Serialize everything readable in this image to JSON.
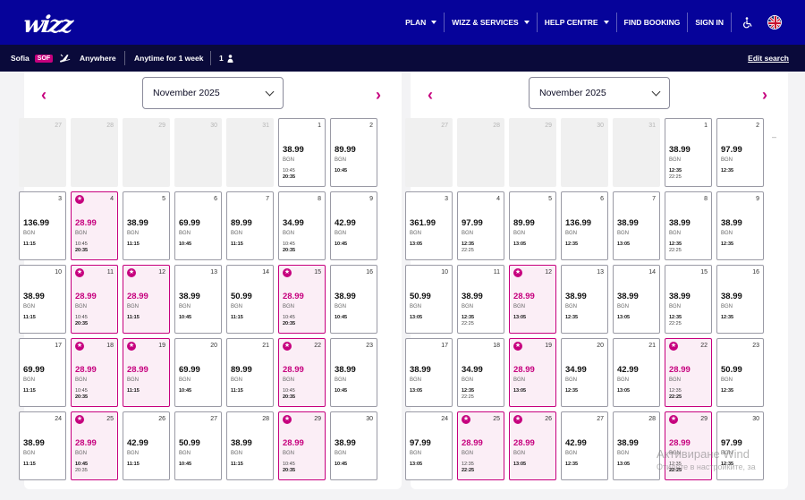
{
  "header": {
    "logo": "wizz",
    "nav": [
      {
        "label": "PLAN",
        "dropdown": true
      },
      {
        "label": "WIZZ & SERVICES",
        "dropdown": true
      },
      {
        "label": "HELP CENTRE",
        "dropdown": true
      },
      {
        "label": "FIND BOOKING",
        "dropdown": false
      },
      {
        "label": "SIGN IN",
        "dropdown": false
      }
    ],
    "accessibility_icon": "wheelchair-icon",
    "language_icon": "uk-flag-icon"
  },
  "search": {
    "origin": "Sofia",
    "origin_code": "SOF",
    "destination": "Anywhere",
    "dates": "Anytime for 1 week",
    "passengers": "1",
    "edit_label": "Edit search"
  },
  "calendars": [
    {
      "month": "November 2025",
      "days": [
        {
          "d": "27",
          "empty": true
        },
        {
          "d": "28",
          "empty": true
        },
        {
          "d": "29",
          "empty": true
        },
        {
          "d": "30",
          "empty": true
        },
        {
          "d": "31",
          "empty": true
        },
        {
          "d": "1",
          "p": "38.99",
          "cur": "BGN",
          "t": [
            "10:45",
            "20:35"
          ],
          "b": [
            false,
            true
          ]
        },
        {
          "d": "2",
          "p": "89.99",
          "cur": "BGN",
          "t": [
            "10:45"
          ],
          "b": [
            true
          ]
        },
        {
          "d": "3",
          "p": "136.99",
          "cur": "BGN",
          "t": [
            "11:15"
          ],
          "b": [
            true
          ]
        },
        {
          "d": "4",
          "p": "28.99",
          "cur": "BGN",
          "sale": true,
          "t": [
            "10:45",
            "20:35"
          ],
          "b": [
            false,
            true
          ]
        },
        {
          "d": "5",
          "p": "38.99",
          "cur": "BGN",
          "t": [
            "11:15"
          ],
          "b": [
            true
          ]
        },
        {
          "d": "6",
          "p": "69.99",
          "cur": "BGN",
          "t": [
            "10:45"
          ],
          "b": [
            true
          ]
        },
        {
          "d": "7",
          "p": "89.99",
          "cur": "BGN",
          "t": [
            "11:15"
          ],
          "b": [
            true
          ]
        },
        {
          "d": "8",
          "p": "34.99",
          "cur": "BGN",
          "t": [
            "10:45",
            "20:35"
          ],
          "b": [
            false,
            true
          ]
        },
        {
          "d": "9",
          "p": "42.99",
          "cur": "BGN",
          "t": [
            "10:45"
          ],
          "b": [
            true
          ]
        },
        {
          "d": "10",
          "p": "38.99",
          "cur": "BGN",
          "t": [
            "11:15"
          ],
          "b": [
            true
          ]
        },
        {
          "d": "11",
          "p": "28.99",
          "cur": "BGN",
          "sale": true,
          "t": [
            "10:45",
            "20:35"
          ],
          "b": [
            false,
            true
          ]
        },
        {
          "d": "12",
          "p": "28.99",
          "cur": "BGN",
          "sale": true,
          "t": [
            "11:15"
          ],
          "b": [
            true
          ]
        },
        {
          "d": "13",
          "p": "38.99",
          "cur": "BGN",
          "t": [
            "10:45"
          ],
          "b": [
            true
          ]
        },
        {
          "d": "14",
          "p": "50.99",
          "cur": "BGN",
          "t": [
            "11:15"
          ],
          "b": [
            true
          ]
        },
        {
          "d": "15",
          "p": "28.99",
          "cur": "BGN",
          "sale": true,
          "t": [
            "10:45",
            "20:35"
          ],
          "b": [
            false,
            true
          ]
        },
        {
          "d": "16",
          "p": "38.99",
          "cur": "BGN",
          "t": [
            "10:45"
          ],
          "b": [
            true
          ]
        },
        {
          "d": "17",
          "p": "69.99",
          "cur": "BGN",
          "t": [
            "11:15"
          ],
          "b": [
            true
          ]
        },
        {
          "d": "18",
          "p": "28.99",
          "cur": "BGN",
          "sale": true,
          "t": [
            "10:45",
            "20:35"
          ],
          "b": [
            false,
            true
          ]
        },
        {
          "d": "19",
          "p": "28.99",
          "cur": "BGN",
          "sale": true,
          "t": [
            "11:15"
          ],
          "b": [
            true
          ]
        },
        {
          "d": "20",
          "p": "69.99",
          "cur": "BGN",
          "t": [
            "10:45"
          ],
          "b": [
            true
          ]
        },
        {
          "d": "21",
          "p": "89.99",
          "cur": "BGN",
          "t": [
            "11:15"
          ],
          "b": [
            true
          ]
        },
        {
          "d": "22",
          "p": "28.99",
          "cur": "BGN",
          "sale": true,
          "t": [
            "10:45",
            "20:35"
          ],
          "b": [
            false,
            true
          ]
        },
        {
          "d": "23",
          "p": "38.99",
          "cur": "BGN",
          "t": [
            "10:45"
          ],
          "b": [
            true
          ]
        },
        {
          "d": "24",
          "p": "38.99",
          "cur": "BGN",
          "t": [
            "11:15"
          ],
          "b": [
            true
          ]
        },
        {
          "d": "25",
          "p": "28.99",
          "cur": "BGN",
          "sale": true,
          "t": [
            "10:45",
            "20:35"
          ],
          "b": [
            true,
            false
          ]
        },
        {
          "d": "26",
          "p": "42.99",
          "cur": "BGN",
          "t": [
            "11:15"
          ],
          "b": [
            true
          ]
        },
        {
          "d": "27",
          "p": "50.99",
          "cur": "BGN",
          "t": [
            "10:45"
          ],
          "b": [
            true
          ]
        },
        {
          "d": "28",
          "p": "38.99",
          "cur": "BGN",
          "t": [
            "11:15"
          ],
          "b": [
            true
          ]
        },
        {
          "d": "29",
          "p": "28.99",
          "cur": "BGN",
          "sale": true,
          "t": [
            "10:45",
            "20:35"
          ],
          "b": [
            false,
            true
          ]
        },
        {
          "d": "30",
          "p": "38.99",
          "cur": "BGN",
          "t": [
            "10:45"
          ],
          "b": [
            true
          ]
        }
      ]
    },
    {
      "month": "November 2025",
      "days": [
        {
          "d": "27",
          "empty": true
        },
        {
          "d": "28",
          "empty": true
        },
        {
          "d": "29",
          "empty": true
        },
        {
          "d": "30",
          "empty": true
        },
        {
          "d": "31",
          "empty": true
        },
        {
          "d": "1",
          "p": "38.99",
          "cur": "BGN",
          "t": [
            "12:35",
            "22:25"
          ],
          "b": [
            true,
            false
          ]
        },
        {
          "d": "2",
          "p": "97.99",
          "cur": "BGN",
          "t": [
            "12:35"
          ],
          "b": [
            true
          ]
        },
        {
          "d": "3",
          "p": "361.99",
          "cur": "BGN",
          "t": [
            "13:05"
          ],
          "b": [
            true
          ]
        },
        {
          "d": "4",
          "p": "97.99",
          "cur": "BGN",
          "t": [
            "12:35",
            "22:25"
          ],
          "b": [
            true,
            false
          ]
        },
        {
          "d": "5",
          "p": "89.99",
          "cur": "BGN",
          "t": [
            "13:05"
          ],
          "b": [
            true
          ]
        },
        {
          "d": "6",
          "p": "136.99",
          "cur": "BGN",
          "t": [
            "12:35"
          ],
          "b": [
            true
          ]
        },
        {
          "d": "7",
          "p": "38.99",
          "cur": "BGN",
          "t": [
            "13:05"
          ],
          "b": [
            true
          ]
        },
        {
          "d": "8",
          "p": "38.99",
          "cur": "BGN",
          "t": [
            "12:35",
            "22:25"
          ],
          "b": [
            true,
            false
          ]
        },
        {
          "d": "9",
          "p": "38.99",
          "cur": "BGN",
          "t": [
            "12:35"
          ],
          "b": [
            true
          ]
        },
        {
          "d": "10",
          "p": "50.99",
          "cur": "BGN",
          "t": [
            "13:05"
          ],
          "b": [
            true
          ]
        },
        {
          "d": "11",
          "p": "38.99",
          "cur": "BGN",
          "t": [
            "12:35",
            "22:25"
          ],
          "b": [
            true,
            false
          ]
        },
        {
          "d": "12",
          "p": "28.99",
          "cur": "BGN",
          "sale": true,
          "t": [
            "13:05"
          ],
          "b": [
            true
          ]
        },
        {
          "d": "13",
          "p": "38.99",
          "cur": "BGN",
          "t": [
            "12:35"
          ],
          "b": [
            true
          ]
        },
        {
          "d": "14",
          "p": "38.99",
          "cur": "BGN",
          "t": [
            "13:05"
          ],
          "b": [
            true
          ]
        },
        {
          "d": "15",
          "p": "38.99",
          "cur": "BGN",
          "t": [
            "12:35",
            "22:25"
          ],
          "b": [
            true,
            false
          ]
        },
        {
          "d": "16",
          "p": "38.99",
          "cur": "BGN",
          "t": [
            "12:35"
          ],
          "b": [
            true
          ]
        },
        {
          "d": "17",
          "p": "38.99",
          "cur": "BGN",
          "t": [
            "13:05"
          ],
          "b": [
            true
          ]
        },
        {
          "d": "18",
          "p": "34.99",
          "cur": "BGN",
          "t": [
            "12:35",
            "22:25"
          ],
          "b": [
            true,
            false
          ]
        },
        {
          "d": "19",
          "p": "28.99",
          "cur": "BGN",
          "sale": true,
          "t": [
            "13:05"
          ],
          "b": [
            true
          ]
        },
        {
          "d": "20",
          "p": "34.99",
          "cur": "BGN",
          "t": [
            "12:35"
          ],
          "b": [
            true
          ]
        },
        {
          "d": "21",
          "p": "42.99",
          "cur": "BGN",
          "t": [
            "13:05"
          ],
          "b": [
            true
          ]
        },
        {
          "d": "22",
          "p": "28.99",
          "cur": "BGN",
          "sale": true,
          "t": [
            "12:35",
            "22:25"
          ],
          "b": [
            false,
            true
          ]
        },
        {
          "d": "23",
          "p": "50.99",
          "cur": "BGN",
          "t": [
            "12:35"
          ],
          "b": [
            true
          ]
        },
        {
          "d": "24",
          "p": "97.99",
          "cur": "BGN",
          "t": [
            "13:05"
          ],
          "b": [
            true
          ]
        },
        {
          "d": "25",
          "p": "28.99",
          "cur": "BGN",
          "sale": true,
          "t": [
            "12:35",
            "22:25"
          ],
          "b": [
            false,
            true
          ]
        },
        {
          "d": "26",
          "p": "28.99",
          "cur": "BGN",
          "sale": true,
          "t": [
            "13:05"
          ],
          "b": [
            true
          ]
        },
        {
          "d": "27",
          "p": "42.99",
          "cur": "BGN",
          "t": [
            "12:35"
          ],
          "b": [
            true
          ]
        },
        {
          "d": "28",
          "p": "38.99",
          "cur": "BGN",
          "t": [
            "13:05"
          ],
          "b": [
            true
          ]
        },
        {
          "d": "29",
          "p": "28.99",
          "cur": "BGN",
          "sale": true,
          "t": [
            "12:35",
            "22:25"
          ],
          "b": [
            false,
            true
          ]
        },
        {
          "d": "30",
          "p": "97.99",
          "cur": "BGN",
          "t": [
            "12:35"
          ],
          "b": [
            true
          ]
        }
      ]
    }
  ],
  "watermark": {
    "line1": "Активиране Wind",
    "line2": "Отидете в настройките, за"
  },
  "colors": {
    "brand": "#06039a",
    "accent": "#c6007e",
    "sale_bg": "#fbeef6"
  }
}
